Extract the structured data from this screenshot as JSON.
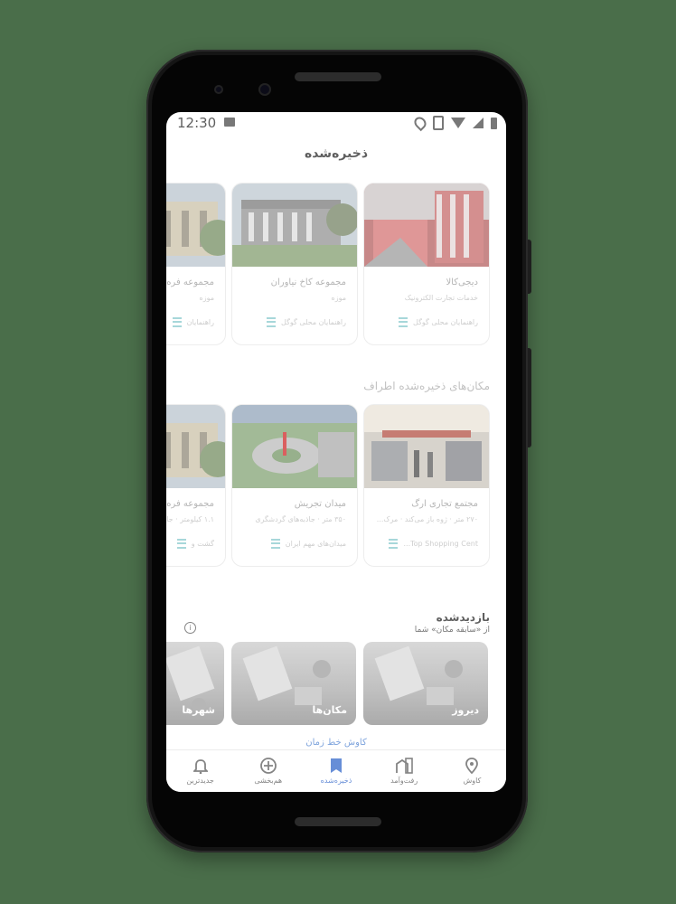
{
  "status_bar": {
    "time": "12:30"
  },
  "header": {
    "title": "ذخیره‌شده"
  },
  "saved_row": [
    {
      "name": "دیجی‌کالا",
      "category": "خدمات تجارت الکترونیک",
      "source": "راهنمایان محلی گوگل"
    },
    {
      "name": "مجموعه کاخ نیاوران",
      "category": "موزه",
      "source": "راهنمایان محلی گوگل"
    },
    {
      "name": "مجموعه فره",
      "category": "موزه",
      "source": "راهنمایان"
    }
  ],
  "nearby": {
    "heading": "مکان‌های ذخیره‌شده اطراف",
    "items": [
      {
        "name": "مجتمع تجاری ارگ",
        "detail": "۲۷۰ متر · ژوه باز می‌کند · مرک...",
        "source": "Top Shopping Cent..."
      },
      {
        "name": "میدان تجریش",
        "detail": "۳۵۰ متر · جاذبه‌های گردشگری",
        "source": "میدان‌های مهم ایران"
      },
      {
        "name": "مجموعه فره",
        "detail": "۱.۱ کیلومتر · جاذ",
        "source": "گشت و"
      }
    ]
  },
  "visited": {
    "title": "بازدیدشده",
    "subtitle": "از «سابقه مکان» شما",
    "tiles": [
      {
        "label": "دیروز"
      },
      {
        "label": "مکان‌ها"
      },
      {
        "label": "شهرها"
      }
    ],
    "timeline_link": "کاوش خط زمان"
  },
  "bottom_nav": [
    {
      "label": "کاوش",
      "icon": "location-pin-icon"
    },
    {
      "label": "رفت‌وآمد",
      "icon": "commute-icon"
    },
    {
      "label": "ذخیره‌شده",
      "icon": "bookmark-icon",
      "active": true
    },
    {
      "label": "هم‌بخشی",
      "icon": "add-circle-icon"
    },
    {
      "label": "جدیدترین",
      "icon": "bell-icon"
    }
  ]
}
